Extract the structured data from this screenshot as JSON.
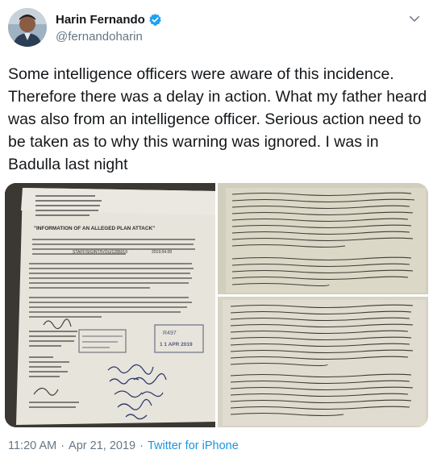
{
  "author": {
    "display_name": "Harin Fernando",
    "handle": "@fernandoharin",
    "verified": true
  },
  "tweet": {
    "text": "Some intelligence officers were aware of this incidence. Therefore there was a delay in action. What my father heard was also from an intelligence officer. Serious action need to be taken as to why this warning was ignored. I was in Badulla last night"
  },
  "media": {
    "letter_heading": "\"INFORMATION OF AN ALLEGED PLAN ATTACK\"",
    "letter_ref_line": "STAFF/SIGINT/IVOU/1286019",
    "letter_stamp_number": "R497",
    "letter_stamp_date": "1 1 APR 2019",
    "letter_date": "2019.04.09"
  },
  "meta": {
    "time": "11:20 AM",
    "date": "Apr 21, 2019",
    "separator": "·",
    "client": "Twitter for iPhone"
  },
  "colors": {
    "link": "#1b95e0",
    "secondary_text": "#657786",
    "verified_badge": "#1da1f2"
  }
}
